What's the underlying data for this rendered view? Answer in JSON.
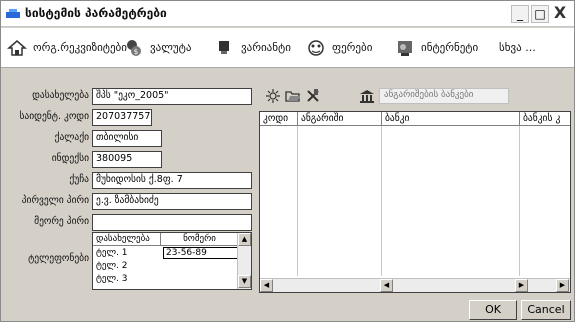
{
  "window": {
    "title": "სისტემის პარამეტრები",
    "minimize_glyph": "_",
    "maximize_glyph": "□",
    "close_glyph": "X"
  },
  "toolbar": {
    "items": [
      {
        "label": "ორგ.რეკვიზიტები",
        "icon": "home-icon"
      },
      {
        "label": "ვალუტა",
        "icon": "currency-icon"
      },
      {
        "label": "ვარიანტი",
        "icon": "document-icon"
      },
      {
        "label": "ფერები",
        "icon": "color-icon"
      },
      {
        "label": "ინტერნეტი",
        "icon": "internet-icon"
      },
      {
        "label": "სხვა ..."
      }
    ]
  },
  "form": {
    "fields": [
      {
        "label": "დასახელება",
        "value": "შპს \"ეკო_2005\""
      },
      {
        "label": "საიდენტ. კოდი",
        "value": "207037757"
      },
      {
        "label": "ქალაქი",
        "value": "თბილისი"
      },
      {
        "label": "ინდექსი",
        "value": "380095"
      },
      {
        "label": "ქუჩა",
        "value": "მუხიდოსის ქ.8ფ. 7"
      },
      {
        "label": "პირველი პირი",
        "value": "ე.ვ. ზამბახიძე"
      },
      {
        "label": "მეორე პირი",
        "value": ""
      }
    ],
    "phones": {
      "label": "ტელეფონები",
      "col_name": "დასახელება",
      "col_number": "ნომერი",
      "rows": [
        {
          "name": "ტელ. 1",
          "number": "23-56-89"
        },
        {
          "name": "ტელ. 2",
          "number": ""
        },
        {
          "name": "ტელ. 3",
          "number": ""
        }
      ]
    }
  },
  "accounts": {
    "search_placeholder": "ანგარიშების ბანკები",
    "columns": [
      "კოდი",
      "ანგარიში",
      "ბანკი",
      "ბანკის კ"
    ]
  },
  "buttons": {
    "ok": "OK",
    "cancel": "Cancel"
  },
  "colors": {
    "chrome": "#d4d0c8",
    "field_border": "#404040"
  }
}
